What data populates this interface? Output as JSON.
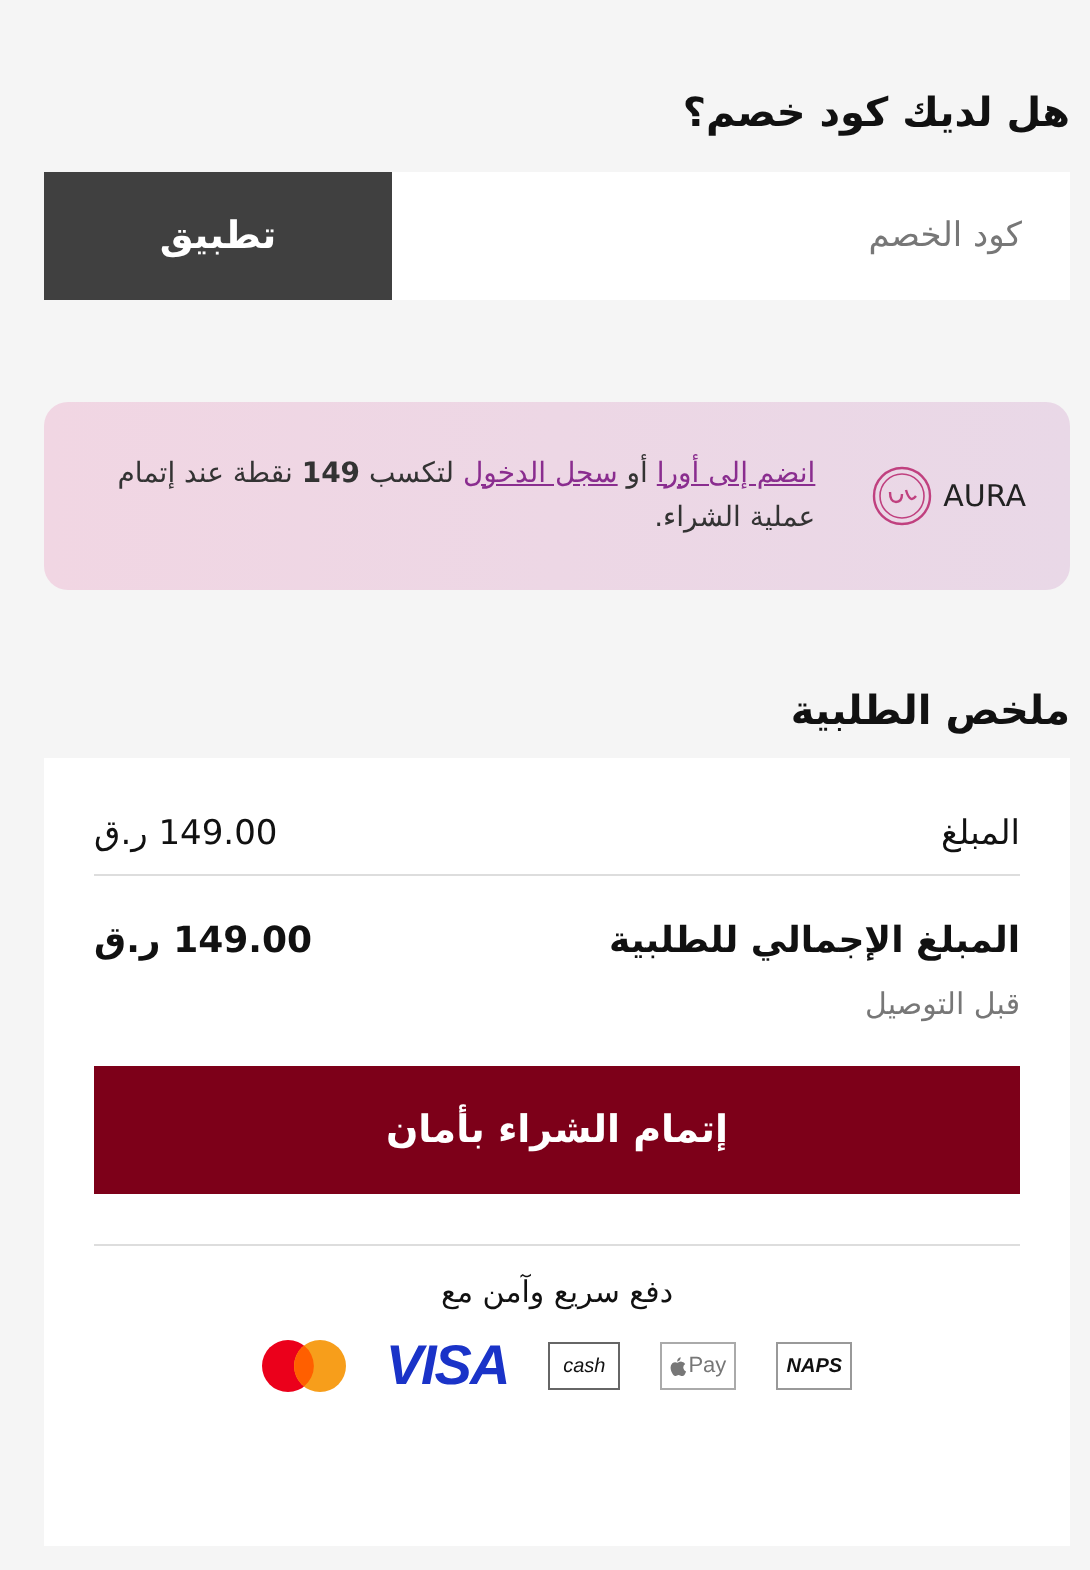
{
  "coupon": {
    "title": "هل لديك كود خصم؟",
    "placeholder": "كود الخصم",
    "apply_button": "تطبيق"
  },
  "aura": {
    "brand": "AURA",
    "join_link": "انضم إلى أورا",
    "or": "أو",
    "login_link": "سجل الدخول",
    "message": "لتكسب **149** نقطة عند إتمام عملية الشراء."
  },
  "summary": {
    "title": "ملخص الطلبية",
    "rows": [
      {
        "kind": "subtotal",
        "label": "المبلغ",
        "value": "149.00 ر.ق"
      },
      {
        "kind": "total",
        "label": "المبلغ الإجمالي للطلبية",
        "value": "149.00 ر.ق"
      }
    ],
    "note": "قبل التوصيل",
    "checkout_button": "إتمام الشراء بأمان",
    "payment_title": "دفع سريع وآمن مع",
    "payment_methods": [
      {
        "kind": "naps",
        "label": "NAPS"
      },
      {
        "kind": "applepay",
        "label": "Pay"
      },
      {
        "kind": "cash",
        "label": "cash"
      },
      {
        "kind": "visa",
        "label": "VISA"
      },
      {
        "kind": "mastercard"
      }
    ]
  }
}
